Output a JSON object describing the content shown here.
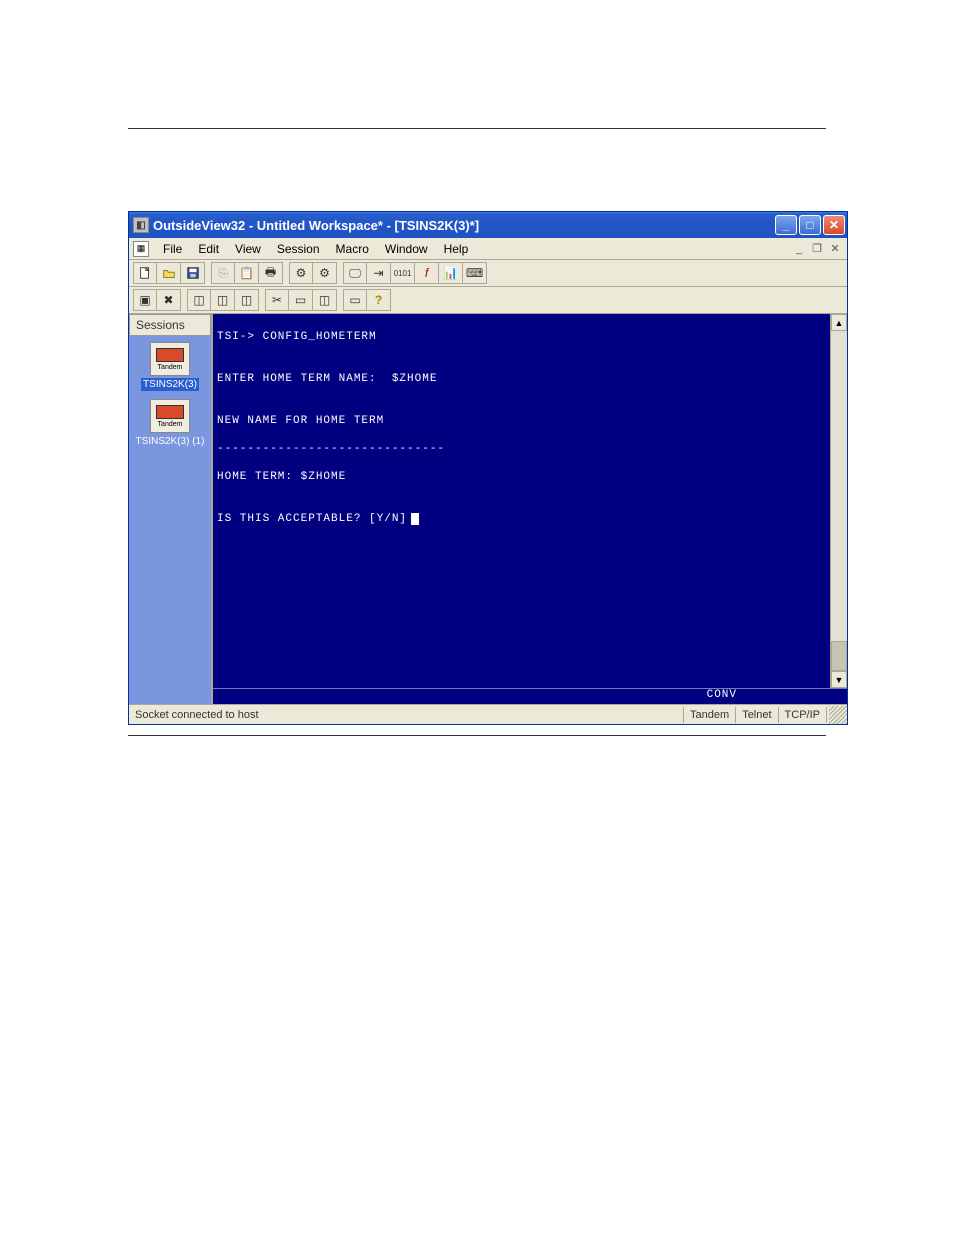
{
  "window": {
    "title": "OutsideView32 - Untitled Workspace* - [TSINS2K(3)*]"
  },
  "menu": {
    "items": [
      "File",
      "Edit",
      "View",
      "Session",
      "Macro",
      "Window",
      "Help"
    ]
  },
  "toolbar1": {
    "groups": [
      [
        "new",
        "open",
        "save"
      ],
      [
        "copy",
        "paste",
        "print"
      ],
      [
        "settings1",
        "settings2"
      ],
      [
        "monitor",
        "connect",
        "binary",
        "function",
        "chart",
        "keyboard"
      ]
    ]
  },
  "toolbar2": {
    "groups": [
      [
        "tool-a",
        "tool-b"
      ],
      [
        "tool-c",
        "tool-d",
        "tool-e"
      ],
      [
        "tool-f",
        "tool-g",
        "tool-h"
      ],
      [
        "tool-i",
        "help"
      ]
    ]
  },
  "sessions": {
    "header": "Sessions",
    "items": [
      {
        "label": "TSINS2K(3)",
        "icon_caption": "Tandem",
        "active": true
      },
      {
        "label": "TSINS2K(3) (1)",
        "icon_caption": "Tandem",
        "active": false
      }
    ]
  },
  "terminal": {
    "lines": [
      "TSI-> CONFIG_HOMETERM",
      "",
      "ENTER HOME TERM NAME:  $ZHOME",
      "",
      "NEW NAME FOR HOME TERM",
      "------------------------------",
      "HOME TERM: $ZHOME",
      "",
      "IS THIS ACCEPTABLE? [Y/N]"
    ],
    "mode": "CONV"
  },
  "status": {
    "message": "Socket connected to host",
    "cells": [
      "Tandem",
      "Telnet",
      "TCP/IP"
    ]
  }
}
